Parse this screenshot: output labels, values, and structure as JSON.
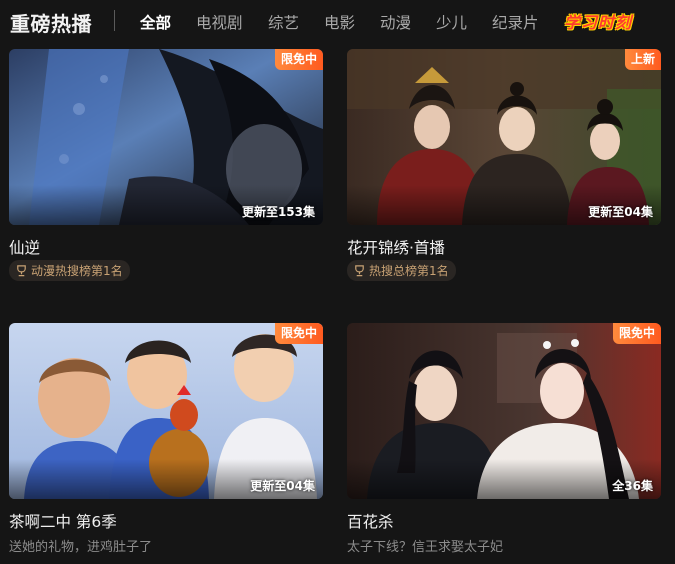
{
  "header": {
    "section_title": "重磅热播",
    "tabs": [
      {
        "label": "全部",
        "active": true
      },
      {
        "label": "电视剧",
        "active": false
      },
      {
        "label": "综艺",
        "active": false
      },
      {
        "label": "电影",
        "active": false
      },
      {
        "label": "动漫",
        "active": false
      },
      {
        "label": "少儿",
        "active": false
      },
      {
        "label": "纪录片",
        "active": false
      }
    ],
    "promo_label": "学习时刻"
  },
  "cards": [
    {
      "title": "仙逆",
      "badge": "限免中",
      "episodes": "更新至153集",
      "rank_tag": "动漫热搜榜第1名",
      "subtitle": null,
      "icon": "trophy-icon"
    },
    {
      "title": "花开锦绣·首播",
      "badge": "上新",
      "episodes": "更新至04集",
      "rank_tag": "热搜总榜第1名",
      "subtitle": null,
      "icon": "trophy-icon"
    },
    {
      "title": "茶啊二中 第6季",
      "badge": "限免中",
      "episodes": "更新至04集",
      "rank_tag": null,
      "subtitle": "送她的礼物，进鸡肚子了"
    },
    {
      "title": "百花杀",
      "badge": "限免中",
      "episodes": "全36集",
      "rank_tag": null,
      "subtitle": "太子下线？信王求娶太子妃"
    }
  ],
  "colors": {
    "background": "#151515",
    "badge_orange": "#ff6a26",
    "rank_text": "#c8a274",
    "promo_red": "#ff3b30",
    "promo_yellow": "#ffd200"
  }
}
